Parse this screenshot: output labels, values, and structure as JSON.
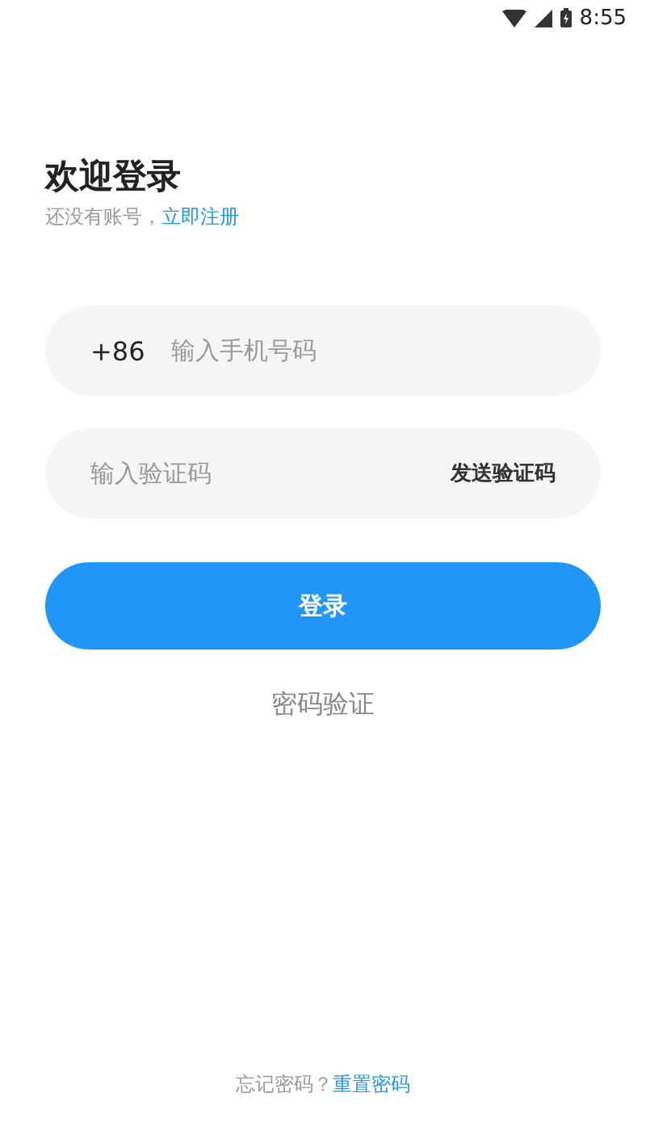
{
  "status_bar": {
    "time": "8:55"
  },
  "header": {
    "title": "欢迎登录",
    "subtitle": "还没有账号，",
    "register_link": "立即注册"
  },
  "phone_field": {
    "prefix": "+86",
    "placeholder": "输入手机号码"
  },
  "code_field": {
    "placeholder": "输入验证码",
    "send_button": "发送验证码"
  },
  "login_button": "登录",
  "password_login_link": "密码验证",
  "footer": {
    "text": "忘记密码？",
    "reset_link": "重置密码"
  }
}
